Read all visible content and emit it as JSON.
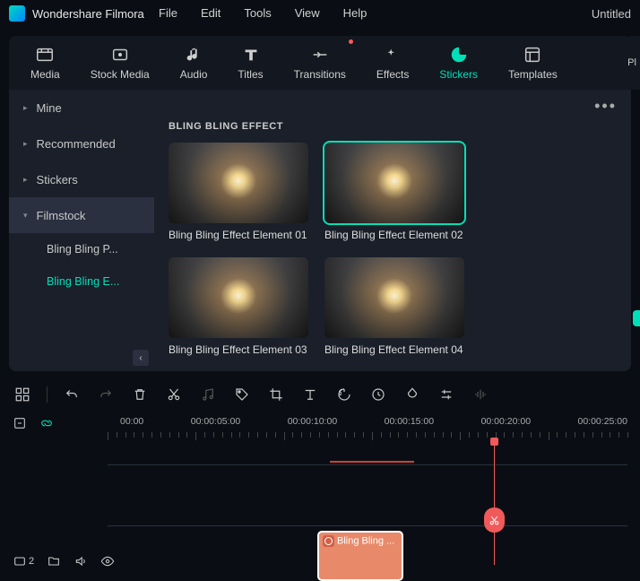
{
  "app": {
    "name": "Wondershare Filmora",
    "project": "Untitled"
  },
  "menu": {
    "file": "File",
    "edit": "Edit",
    "tools": "Tools",
    "view": "View",
    "help": "Help"
  },
  "tabs": {
    "media": "Media",
    "stockmedia": "Stock Media",
    "audio": "Audio",
    "titles": "Titles",
    "transitions": "Transitions",
    "effects": "Effects",
    "stickers": "Stickers",
    "templates": "Templates",
    "active": "stickers"
  },
  "preview_stub": "Pl",
  "sidebar": {
    "items": [
      {
        "label": "Mine"
      },
      {
        "label": "Recommended"
      },
      {
        "label": "Stickers"
      },
      {
        "label": "Filmstock",
        "expanded": true
      }
    ],
    "sub": [
      {
        "label": "Bling Bling P..."
      },
      {
        "label": "Bling Bling E...",
        "active": true
      }
    ],
    "collapse": "‹"
  },
  "gallery": {
    "more": "•••",
    "title": "BLING BLING EFFECT",
    "cards": [
      {
        "name": "Bling Bling Effect Element 01"
      },
      {
        "name": "Bling Bling Effect Element 02",
        "selected": true
      },
      {
        "name": "Bling Bling Effect Element 03"
      },
      {
        "name": "Bling Bling Effect Element 04"
      }
    ]
  },
  "ruler": [
    "00:00",
    "00:00:05:00",
    "00:00:10:00",
    "00:00:15:00",
    "00:00:20:00",
    "00:00:25:00"
  ],
  "clip": {
    "label": "Bling Bling ..."
  },
  "track_badge": "2"
}
